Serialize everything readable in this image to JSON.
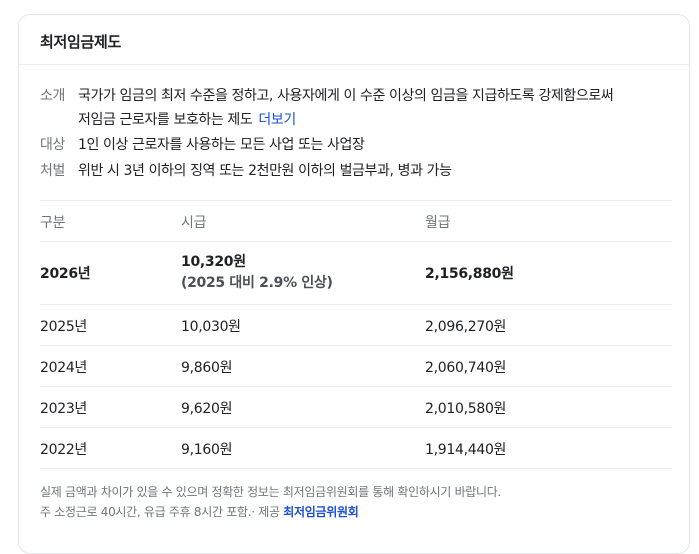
{
  "card": {
    "title": "최저임금제도"
  },
  "info": {
    "intro_label": "소개",
    "intro_line1": "국가가 임금의 최저 수준을 정하고, 사용자에게 이 수준 이상의 임금을 지급하도록 강제함으로써",
    "intro_line2": "저임금 근로자를 보호하는 제도",
    "more_label": "더보기",
    "target_label": "대상",
    "target_value": "1인 이상 근로자를 사용하는 모든 사업 또는 사업장",
    "penalty_label": "처벌",
    "penalty_value": "위반 시 3년 이하의 징역 또는 2천만원 이하의 벌금부과, 병과 가능"
  },
  "table": {
    "headers": [
      "구분",
      "시급",
      "월급"
    ],
    "highlight_row": {
      "year": "2026년",
      "hourly": "10,320원",
      "hourly_note": "(2025 대비 2.9% 인상)",
      "monthly": "2,156,880원"
    },
    "rows": [
      {
        "year": "2025년",
        "hourly": "10,030원",
        "monthly": "2,096,270원"
      },
      {
        "year": "2024년",
        "hourly": "9,860원",
        "monthly": "2,060,740원"
      },
      {
        "year": "2023년",
        "hourly": "9,620원",
        "monthly": "2,010,580원"
      },
      {
        "year": "2022년",
        "hourly": "9,160원",
        "monthly": "1,914,440원"
      }
    ]
  },
  "footnote": {
    "line1": "실제 금액과 차이가 있을 수 있으며 정확한 정보는 최저임금위원회를 통해 확인하시기 바랍니다.",
    "line2_prefix": "주 소정근로 40시간, 유급 주휴 8시간 포함.· 제공",
    "source_link": "최저임금위원회"
  }
}
